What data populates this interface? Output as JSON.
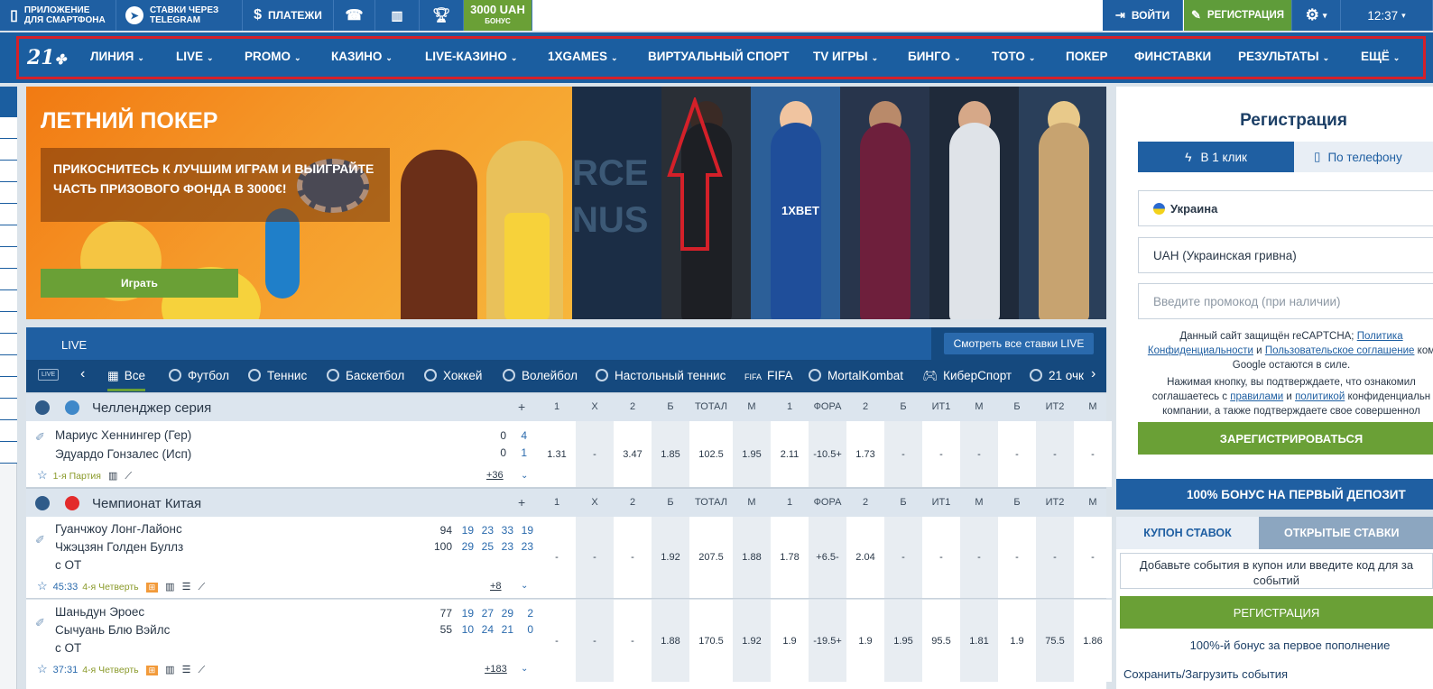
{
  "topbar": {
    "app": "Приложение для смартфона",
    "telegram": "Ставки через Telegram",
    "payments": "Платежи",
    "bonus_amount": "3000 UAH",
    "bonus_label": "бонус",
    "login": "Войти",
    "register": "Регистрация",
    "time": "12:37"
  },
  "nav": {
    "logo": "21",
    "items": [
      "Линия",
      "Live",
      "Promo",
      "Казино",
      "Live-казино",
      "1xGames",
      "Виртуальный спорт",
      "TV игры",
      "Бинго",
      "Тото",
      "Покер",
      "Финставки",
      "Результаты",
      "Ещё"
    ]
  },
  "banner": {
    "title": "Летний покер",
    "text": "Прикоснитесь к лучшим играм и выиграйте часть призового фонда в 3000€!",
    "button": "Играть",
    "strip1_text": "RCE NUS",
    "strip_logo": "1XBET"
  },
  "live": {
    "title": "LIVE",
    "see_all": "Смотреть все ставки LIVE",
    "badge": "LIVE",
    "sports": [
      "Все",
      "Футбол",
      "Теннис",
      "Баскетбол",
      "Хоккей",
      "Волейбол",
      "Настольный теннис",
      "FIFA",
      "MortalKombat",
      "КиберСпорт",
      "21 очк"
    ]
  },
  "columns": [
    "+",
    "1",
    "X",
    "2",
    "Б",
    "ТОТАЛ",
    "М",
    "1",
    "ФОРА",
    "2",
    "Б",
    "ИТ1",
    "М",
    "Б",
    "ИТ2",
    "М"
  ],
  "championships": [
    {
      "name": "Челленджер серия",
      "matches": [
        {
          "team1": "Мариус Хеннингер (Гер)",
          "team2": "Эдуардо Гонзалес (Исп)",
          "extra": "",
          "scores1": [
            "0",
            "4"
          ],
          "scores2": [
            "0",
            "1"
          ],
          "time": "",
          "period": "1-я Партия",
          "more": "+36",
          "odds": [
            "1.31",
            "-",
            "3.47",
            "1.85",
            "102.5",
            "1.95",
            "2.11",
            "-10.5+",
            "1.73",
            "-",
            "-",
            "-",
            "-",
            "-",
            "-"
          ]
        }
      ]
    },
    {
      "name": "Чемпионат Китая",
      "matches": [
        {
          "team1": "Гуанчжоу Лонг-Лайонс",
          "team2": "Чжэцзян Голден Буллз",
          "extra": "с ОТ",
          "scores1": [
            "94",
            "19",
            "23",
            "33",
            "19"
          ],
          "scores2": [
            "100",
            "29",
            "25",
            "23",
            "23"
          ],
          "time": "45:33",
          "period": "4-я Четверть",
          "more": "+8",
          "odds": [
            "-",
            "-",
            "-",
            "1.92",
            "207.5",
            "1.88",
            "1.78",
            "+6.5-",
            "2.04",
            "-",
            "-",
            "-",
            "-",
            "-",
            "-"
          ]
        },
        {
          "team1": "Шаньдун Эроес",
          "team2": "Сычуань Блю Вэйлс",
          "extra": "с ОТ",
          "scores1": [
            "77",
            "19",
            "27",
            "29",
            "2"
          ],
          "scores2": [
            "55",
            "10",
            "24",
            "21",
            "0"
          ],
          "time": "37:31",
          "period": "4-я Четверть",
          "more": "+183",
          "odds": [
            "-",
            "-",
            "-",
            "1.88",
            "170.5",
            "1.92",
            "1.9",
            "-19.5+",
            "1.9",
            "1.95",
            "95.5",
            "1.81",
            "1.9",
            "75.5",
            "1.86"
          ]
        }
      ]
    }
  ],
  "register": {
    "title": "Регистрация",
    "tab_click": "В 1 клик",
    "tab_phone": "По телефону",
    "country": "Украина",
    "currency": "UAH (Украинская гривна)",
    "promo_placeholder": "Введите промокод (при наличии)",
    "captcha_line1": "Данный сайт защищён reCAPTCHA;",
    "captcha_link1": "Политика",
    "captcha_link2": "Конфиденциальности",
    "captcha_and": "и",
    "captcha_link3": "Пользовательское соглашение",
    "captcha_tail": "ком",
    "captcha_line3": "Google остаются в силе.",
    "consent_line1": "Нажимая кнопку, вы подтверждаете, что ознакомил",
    "consent_pre": "соглашаетесь с",
    "consent_link1": "правилами",
    "consent_link2": "политикой",
    "consent_post": "конфиденциальн",
    "consent_line3": "компании, а также подтверждаете свое совершеннол",
    "button": "Зарегистрироваться",
    "bonus": "100% бонус на первый депозит"
  },
  "coupon": {
    "tab_coupon": "Купон ставок",
    "tab_open": "Открытые ставки",
    "note": "Добавьте события в купон или введите код для за событий",
    "button": "Регистрация",
    "bonus": "100%-й бонус за первое пополнение",
    "save": "Сохранить/Загрузить события"
  },
  "colors": {
    "nav_blue": "#1b5ea0",
    "accent_green": "#6aa036",
    "highlight_red": "#d42029"
  }
}
